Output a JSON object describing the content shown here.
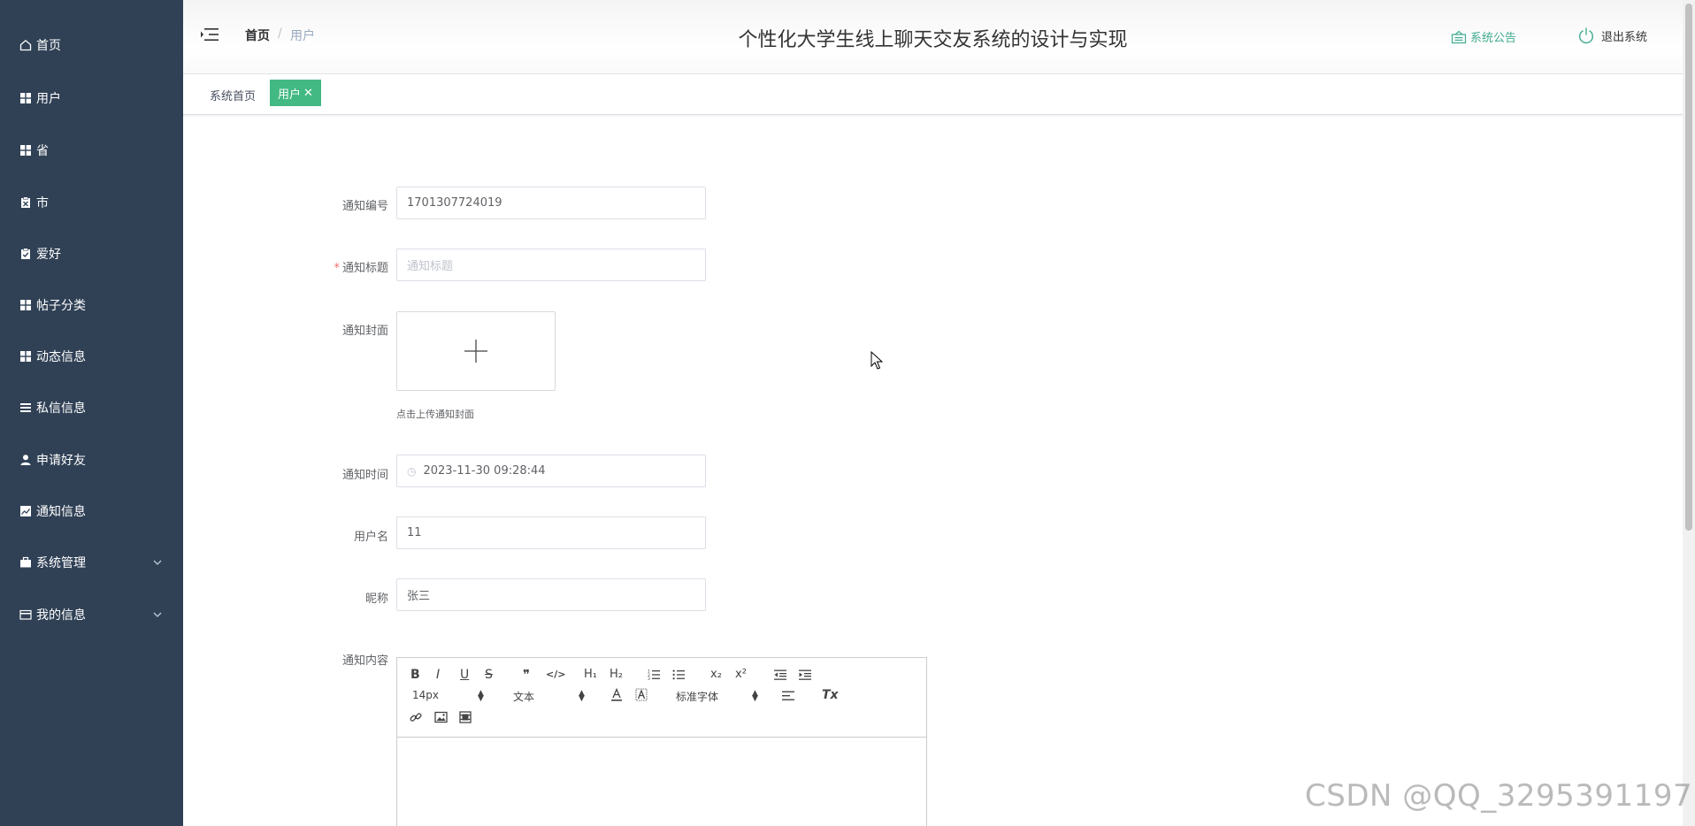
{
  "sidebar": {
    "items": [
      {
        "label": "首页",
        "icon": "home-icon"
      },
      {
        "label": "用户",
        "icon": "grid-icon"
      },
      {
        "label": "省",
        "icon": "grid-icon"
      },
      {
        "label": "市",
        "icon": "clipboard-x-icon"
      },
      {
        "label": "爱好",
        "icon": "clipboard-check-icon"
      },
      {
        "label": "帖子分类",
        "icon": "grid-icon"
      },
      {
        "label": "动态信息",
        "icon": "grid-icon"
      },
      {
        "label": "私信信息",
        "icon": "list-icon"
      },
      {
        "label": "申请好友",
        "icon": "user-icon"
      },
      {
        "label": "通知信息",
        "icon": "chart-icon"
      },
      {
        "label": "系统管理",
        "icon": "briefcase-icon"
      },
      {
        "label": "我的信息",
        "icon": "card-icon"
      }
    ]
  },
  "header": {
    "breadcrumb_home": "首页",
    "breadcrumb_sep": "/",
    "breadcrumb_current": "用户",
    "title": "个性化大学生线上聊天交友系统的设计与实现",
    "notice_label": "系统公告",
    "logout_label": "退出系统"
  },
  "tags": {
    "home": "系统首页",
    "active": "用户",
    "close": "✕"
  },
  "form": {
    "notice_no": {
      "label": "通知编号",
      "value": "1701307724019"
    },
    "notice_title": {
      "label": "通知标题",
      "required": "*",
      "placeholder": "通知标题"
    },
    "notice_cover": {
      "label": "通知封面",
      "tip": "点击上传通知封面"
    },
    "notice_time": {
      "label": "通知时间",
      "value": "2023-11-30 09:28:44"
    },
    "username": {
      "label": "用户名",
      "value": "11"
    },
    "nickname": {
      "label": "昵称",
      "value": "张三"
    },
    "content": {
      "label": "通知内容"
    }
  },
  "editor": {
    "bold": "B",
    "italic": "I",
    "underline": "U",
    "strike": "S",
    "quote": "❞",
    "code": "</>",
    "h1": "H₁",
    "h2": "H₂",
    "subscript": "x₂",
    "superscript": "x²",
    "font_size": "14px",
    "text_style": "文本",
    "font_family": "标准字体",
    "clean": "Tx"
  },
  "colors": {
    "sidebar_bg": "#304156",
    "accent": "#42b983",
    "notice": "#41ab8f",
    "required": "#f56c6c"
  },
  "watermark": "CSDN @QQ_3295391197"
}
